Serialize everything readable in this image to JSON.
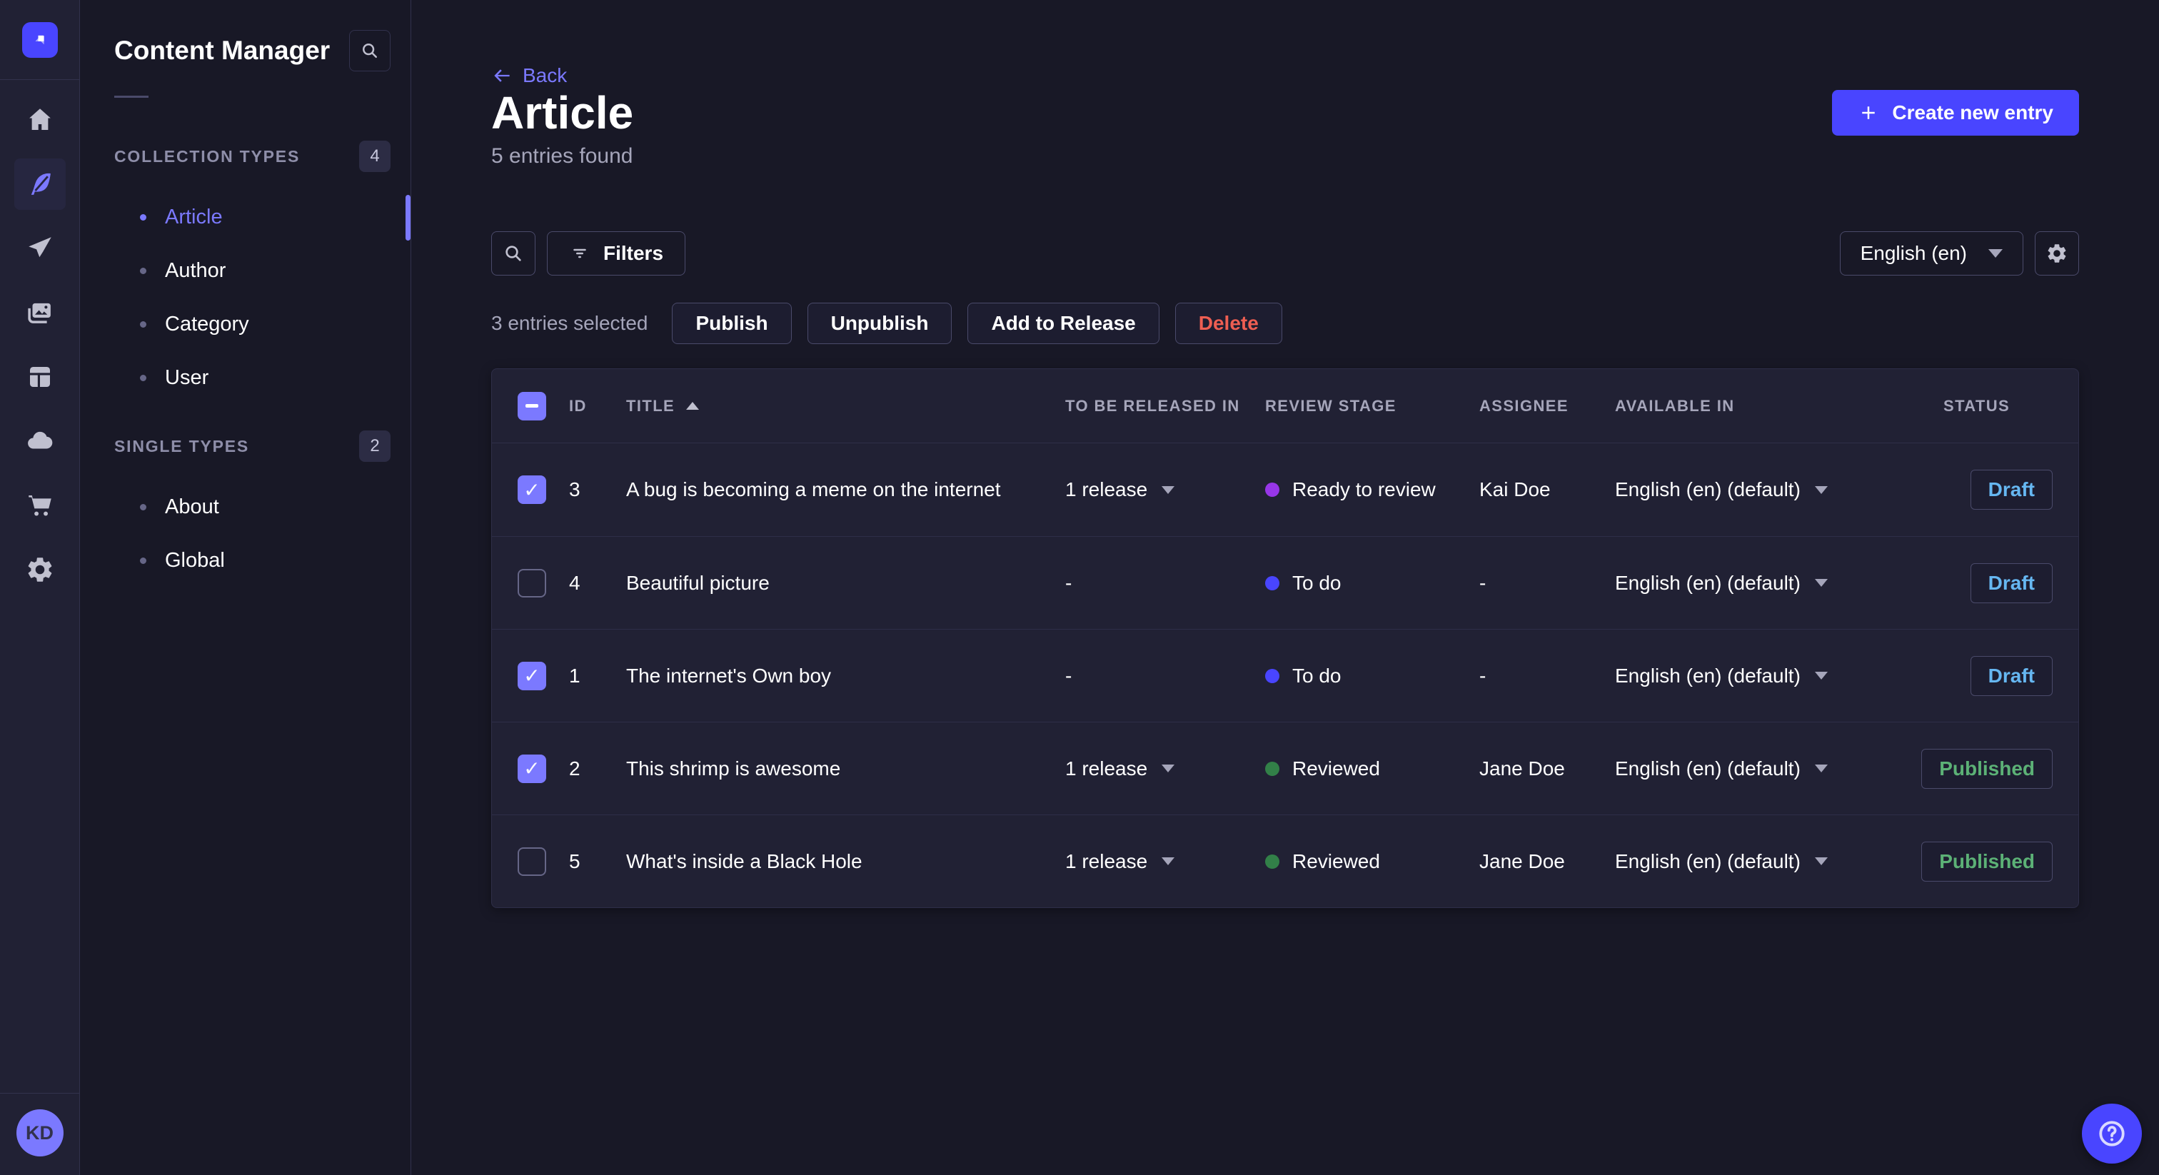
{
  "rail": {
    "logo_icon": "strapi-logo-icon",
    "items": [
      {
        "icon": "home-icon",
        "active": false
      },
      {
        "icon": "feather-icon",
        "active": true
      },
      {
        "icon": "paper-plane-icon",
        "active": false
      },
      {
        "icon": "media-library-icon",
        "active": false
      },
      {
        "icon": "layout-icon",
        "active": false
      },
      {
        "icon": "cloud-icon",
        "active": false
      },
      {
        "icon": "cart-icon",
        "active": false
      },
      {
        "icon": "gear-icon",
        "active": false
      }
    ],
    "avatar_initials": "KD"
  },
  "sidebar": {
    "title": "Content Manager",
    "search_icon": "search-icon",
    "sections": [
      {
        "label": "COLLECTION TYPES",
        "badge": "4",
        "items": [
          {
            "label": "Article",
            "active": true
          },
          {
            "label": "Author",
            "active": false
          },
          {
            "label": "Category",
            "active": false
          },
          {
            "label": "User",
            "active": false
          }
        ]
      },
      {
        "label": "SINGLE TYPES",
        "badge": "2",
        "items": [
          {
            "label": "About",
            "active": false
          },
          {
            "label": "Global",
            "active": false
          }
        ]
      }
    ]
  },
  "header": {
    "back_label": "Back",
    "title": "Article",
    "subtitle": "5 entries found",
    "create_button_label": "Create new entry"
  },
  "toolbar": {
    "filters_label": "Filters",
    "locale_value": "English (en)"
  },
  "selection": {
    "text": "3 entries selected",
    "publish_label": "Publish",
    "unpublish_label": "Unpublish",
    "add_to_release_label": "Add to Release",
    "delete_label": "Delete"
  },
  "table": {
    "headers": {
      "id": "ID",
      "title": "TITLE",
      "released": "TO BE RELEASED IN",
      "stage": "REVIEW STAGE",
      "assignee": "ASSIGNEE",
      "available": "AVAILABLE IN",
      "status": "STATUS"
    },
    "sort": {
      "column": "TITLE",
      "direction": "ascending"
    },
    "rows": [
      {
        "checked": true,
        "id": "3",
        "title": "A bug is becoming a meme on the internet",
        "released": "1 release",
        "stage": "Ready to review",
        "stage_color": "#9736e8",
        "assignee": "Kai Doe",
        "available": "English (en) (default)",
        "status": "Draft"
      },
      {
        "checked": false,
        "id": "4",
        "title": "Beautiful picture",
        "released": "-",
        "stage": "To do",
        "stage_color": "#4945ff",
        "assignee": "-",
        "available": "English (en) (default)",
        "status": "Draft"
      },
      {
        "checked": true,
        "id": "1",
        "title": "The internet's Own boy",
        "released": "-",
        "stage": "To do",
        "stage_color": "#4945ff",
        "assignee": "-",
        "available": "English (en) (default)",
        "status": "Draft"
      },
      {
        "checked": true,
        "id": "2",
        "title": "This shrimp is awesome",
        "released": "1 release",
        "stage": "Reviewed",
        "stage_color": "#328048",
        "assignee": "Jane Doe",
        "available": "English (en) (default)",
        "status": "Published"
      },
      {
        "checked": false,
        "id": "5",
        "title": "What's inside a Black Hole",
        "released": "1 release",
        "stage": "Reviewed",
        "stage_color": "#328048",
        "assignee": "Jane Doe",
        "available": "English (en) (default)",
        "status": "Published"
      }
    ]
  },
  "help": {
    "icon": "question-mark-icon"
  },
  "colors": {
    "primary": "#4945ff",
    "accent": "#7b79ff",
    "delete_red": "#ee5e52",
    "status": {
      "Draft": "#66b7f1",
      "Published": "#5cb176"
    }
  }
}
